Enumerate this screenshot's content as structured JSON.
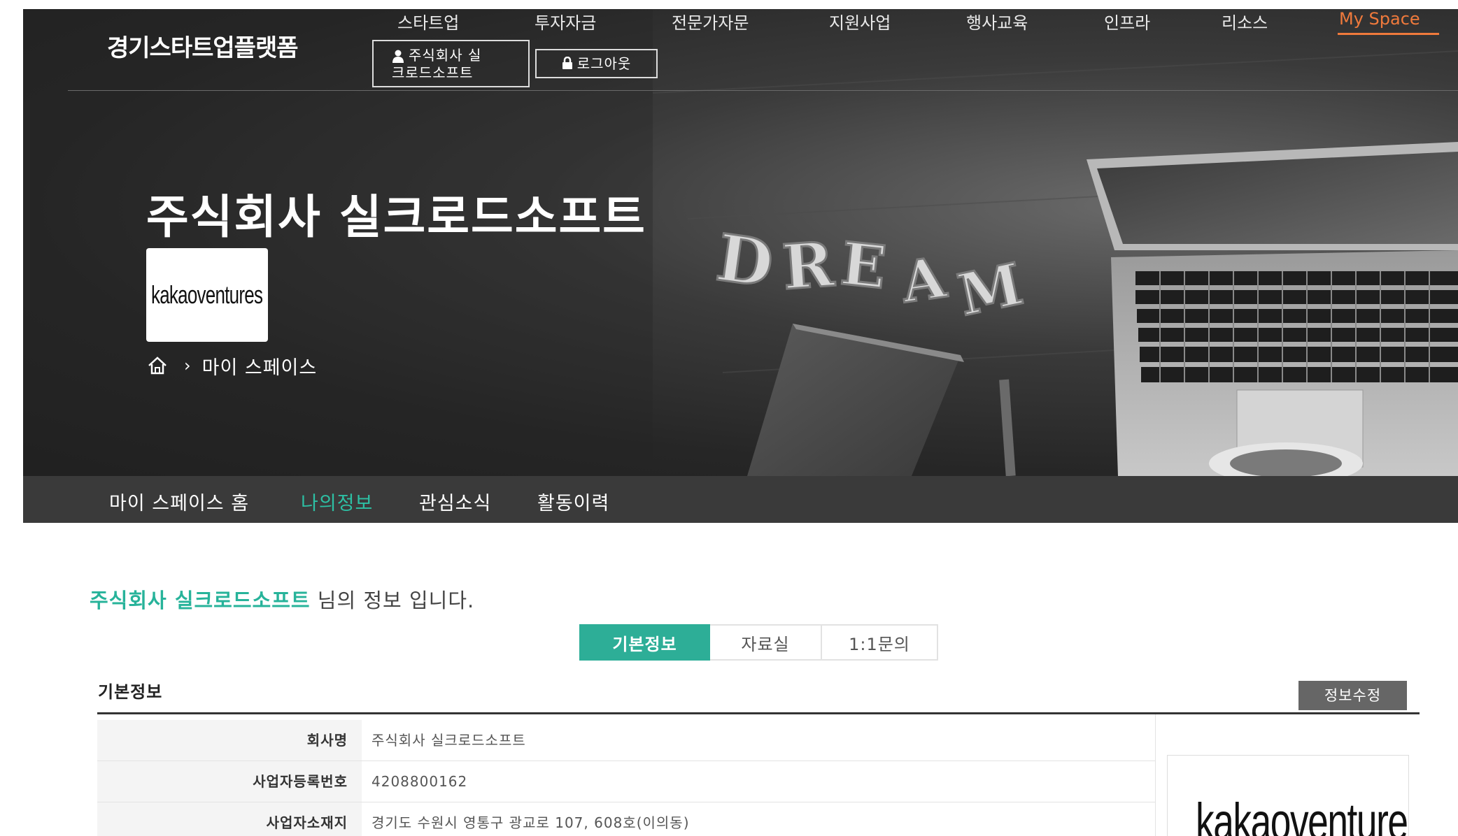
{
  "header": {
    "site_title": "경기스타트업플랫폼",
    "nav": [
      {
        "label": "스타트업"
      },
      {
        "label": "투자자금"
      },
      {
        "label": "전문가자문"
      },
      {
        "label": "지원사업"
      },
      {
        "label": "행사교육"
      },
      {
        "label": "인프라"
      },
      {
        "label": "리소스"
      },
      {
        "label": "My Space",
        "active": true
      }
    ],
    "user_label_line1": "주식회사 실",
    "user_label_line2": "크로드소프트",
    "logout_label": "로그아웃",
    "accent_color": "#f07a3c"
  },
  "hero": {
    "company_name": "주식회사 실크로드소프트",
    "company_logo_text": "kakaoventures",
    "breadcrumb": {
      "home_icon": "home-icon",
      "current": "마이 스페이스"
    },
    "background_text": "DREAM"
  },
  "subnav": {
    "items": [
      {
        "label": "마이 스페이스 홈"
      },
      {
        "label": "나의정보",
        "active": true
      },
      {
        "label": "관심소식"
      },
      {
        "label": "활동이력"
      }
    ],
    "active_color": "#2dc0a4"
  },
  "main": {
    "greeting_name": "주식회사 실크로드소프트",
    "greeting_suffix": " 님의 정보 입니다.",
    "tabs": [
      {
        "label": "기본정보",
        "active": true
      },
      {
        "label": "자료실"
      },
      {
        "label": "1:1문의"
      }
    ],
    "section_title": "기본정보",
    "edit_button": "정보수정",
    "rows": [
      {
        "label": "회사명",
        "value": "주식회사 실크로드소프트"
      },
      {
        "label": "사업자등록번호",
        "value": "4208800162"
      },
      {
        "label": "사업자소재지",
        "value": "경기도 수원시 영통구 광교로 107, 608호(이의동)"
      }
    ],
    "side_logo_text": "kakaoventures",
    "accent_color": "#2dae97"
  }
}
